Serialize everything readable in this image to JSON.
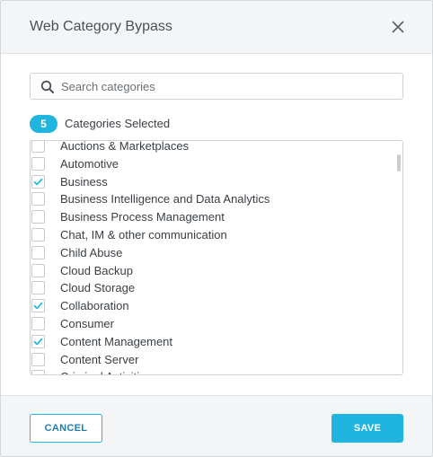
{
  "dialog": {
    "title": "Web Category Bypass",
    "close_icon": "close-icon"
  },
  "search": {
    "placeholder": "Search categories",
    "value": "",
    "icon": "search-icon"
  },
  "selection": {
    "count": "5",
    "label": "Categories Selected"
  },
  "categories": [
    {
      "label": "Auctions & Marketplaces",
      "checked": false
    },
    {
      "label": "Automotive",
      "checked": false
    },
    {
      "label": "Business",
      "checked": true
    },
    {
      "label": "Business Intelligence and Data Analytics",
      "checked": false
    },
    {
      "label": "Business Process Management",
      "checked": false
    },
    {
      "label": "Chat, IM & other communication",
      "checked": false
    },
    {
      "label": "Child Abuse",
      "checked": false
    },
    {
      "label": "Cloud Backup",
      "checked": false
    },
    {
      "label": "Cloud Storage",
      "checked": false
    },
    {
      "label": "Collaboration",
      "checked": true
    },
    {
      "label": "Consumer",
      "checked": false
    },
    {
      "label": "Content Management",
      "checked": true
    },
    {
      "label": "Content Server",
      "checked": false
    },
    {
      "label": "Criminal Activities",
      "checked": false
    }
  ],
  "footer": {
    "cancel_label": "CANCEL",
    "save_label": "SAVE"
  },
  "colors": {
    "accent": "#1fb5de",
    "header_bg": "#f4f5f6",
    "text": "#3a3f44"
  }
}
